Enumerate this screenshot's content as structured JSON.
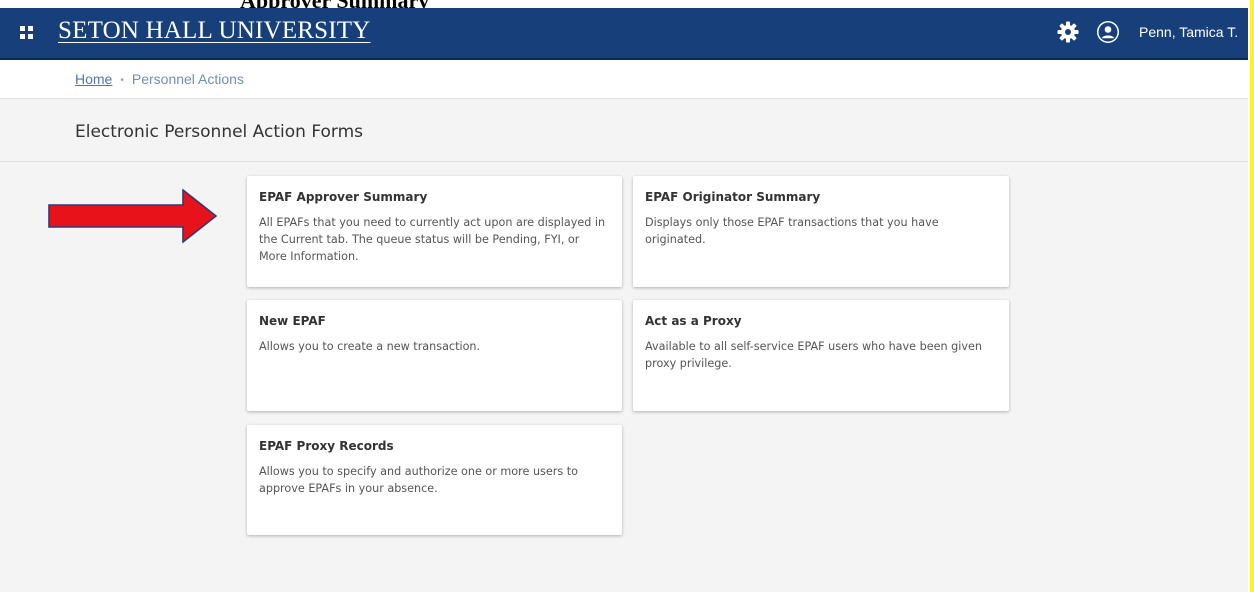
{
  "document": {
    "heading": "Approver Summary"
  },
  "topbar": {
    "brand": "SETON HALL UNIVERSITY",
    "menu_icon": "grid-menu-icon",
    "settings_icon": "gear-icon",
    "profile_icon": "user-icon",
    "user_name": "Penn, Tamica T.",
    "background_color": "#17407b"
  },
  "breadcrumb": {
    "home": "Home",
    "separator": "•",
    "current": "Personnel Actions"
  },
  "page": {
    "title": "Electronic Personnel Action Forms"
  },
  "cards": [
    {
      "title": "EPAF Approver Summary",
      "description": "All EPAFs that you need to currently act upon are displayed in the Current tab. The queue status will be Pending, FYI, or More Information."
    },
    {
      "title": "EPAF Originator Summary",
      "description": "Displays only those EPAF transactions that you have originated."
    },
    {
      "title": "New EPAF",
      "description": "Allows you to create a new transaction."
    },
    {
      "title": "Act as a Proxy",
      "description": "Available to all self-service EPAF users who have been given proxy privilege."
    },
    {
      "title": "EPAF Proxy Records",
      "description": "Allows you to specify and authorize one or more users to approve EPAFs in your absence."
    }
  ],
  "annotation": {
    "arrow_color": "#e8121b",
    "arrow_points_to": "EPAF Approver Summary"
  }
}
